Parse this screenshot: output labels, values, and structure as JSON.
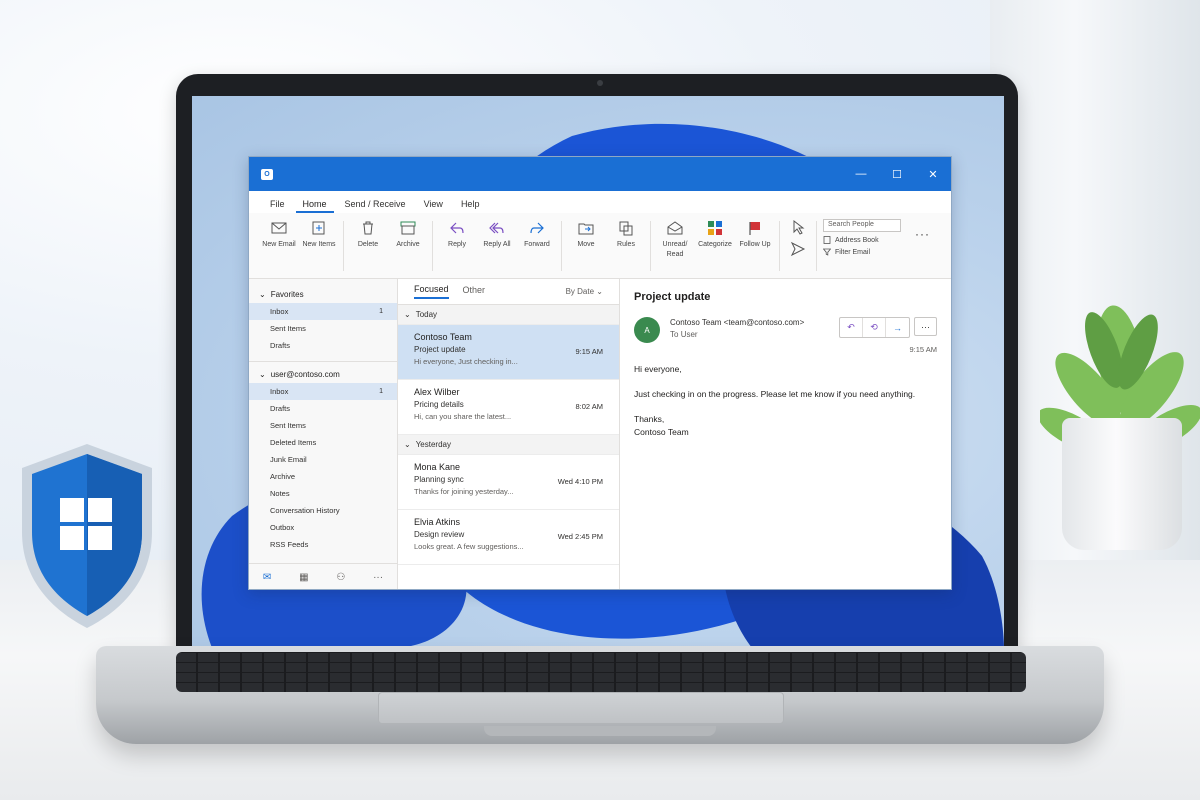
{
  "app": {
    "logo": "O",
    "controls": {
      "minimize": "—",
      "maximize": "☐",
      "close": "✕"
    }
  },
  "menu": [
    {
      "label": "File"
    },
    {
      "label": "Home",
      "active": true
    },
    {
      "label": "Send / Receive"
    },
    {
      "label": "View"
    },
    {
      "label": "Help"
    }
  ],
  "ribbon": {
    "new_email": "New Email",
    "new_items": "New Items",
    "delete": "Delete",
    "archive": "Archive",
    "reply": "Reply",
    "reply_all": "Reply All",
    "forward": "Forward",
    "move": "Move",
    "rules": "Rules",
    "unread_read": "Unread/ Read",
    "categorize": "Categorize",
    "follow_up": "Follow Up",
    "search_people_placeholder": "Search People",
    "address_book": "Address Book",
    "filter_email": "Filter Email",
    "more": "···"
  },
  "nav": {
    "favorites_label": "Favorites",
    "favorites": [
      {
        "label": "Inbox",
        "count": "1",
        "selected": true
      },
      {
        "label": "Sent Items"
      },
      {
        "label": "Drafts"
      }
    ],
    "account_label": "user@contoso.com",
    "folders": [
      {
        "label": "Inbox",
        "count": "1",
        "selected": true
      },
      {
        "label": "Drafts"
      },
      {
        "label": "Sent Items"
      },
      {
        "label": "Deleted Items"
      },
      {
        "label": "Junk Email"
      },
      {
        "label": "Archive"
      },
      {
        "label": "Notes"
      },
      {
        "label": "Conversation History"
      },
      {
        "label": "Outbox"
      },
      {
        "label": "RSS Feeds"
      }
    ]
  },
  "list": {
    "tab_focused": "Focused",
    "tab_other": "Other",
    "sort_label": "By Date",
    "groups": [
      {
        "label": "Today",
        "messages": [
          {
            "from": "Contoso Team",
            "subject": "Project update",
            "preview": "Hi everyone, Just checking in...",
            "time": "9:15 AM",
            "selected": true
          },
          {
            "from": "Alex Wilber",
            "subject": "Pricing details",
            "preview": "Hi, can you share the latest...",
            "time": "8:02 AM"
          }
        ]
      },
      {
        "label": "Yesterday",
        "messages": [
          {
            "from": "Mona Kane",
            "subject": "Planning sync",
            "preview": "Thanks for joining yesterday...",
            "time": "Wed 4:10 PM"
          },
          {
            "from": "Elvia Atkins",
            "subject": "Design review",
            "preview": "Looks great. A few suggestions...",
            "time": "Wed 2:45 PM"
          }
        ]
      }
    ]
  },
  "reading": {
    "subject": "Project update",
    "avatar_initials": "A",
    "from": "Contoso Team <team@contoso.com>",
    "to_label": "To",
    "to": "User",
    "time": "9:15 AM",
    "greeting": "Hi everyone,",
    "body": "Just checking in on the progress. Please let me know if you need anything.",
    "signoff": "Thanks,",
    "signature": "Contoso Team"
  },
  "colors": {
    "accent": "#1a6fd4",
    "selected_row": "#cfe0f3",
    "avatar": "#3a8a4f"
  }
}
